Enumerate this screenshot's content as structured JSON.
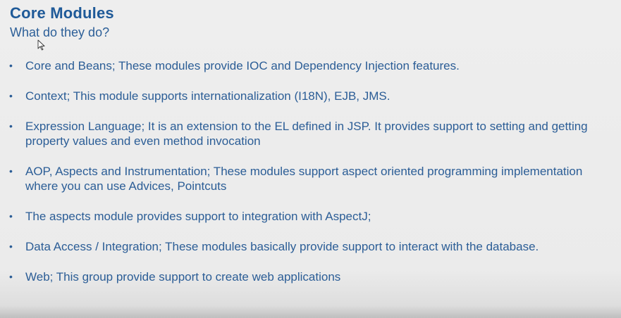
{
  "slide": {
    "title": "Core Modules",
    "subtitle": "What do they do?",
    "bullets": [
      "Core and Beans; These modules provide IOC and Dependency Injection features.",
      "Context; This module supports internationalization (I18N), EJB, JMS.",
      "Expression Language; It is an extension to the EL defined in JSP. It provides support to setting and getting property values and even method invocation",
      "AOP, Aspects and Instrumentation; These modules support aspect oriented programming implementation where you can use Advices, Pointcuts",
      "The aspects module provides support to integration with AspectJ;",
      "Data Access / Integration; These modules basically provide support to interact with the database.",
      "Web; This group provide support to create web applications"
    ]
  },
  "colors": {
    "title": "#1f5a98",
    "text": "#2b5d96",
    "background": "#ececec"
  },
  "icons": {
    "cursor": "mouse-pointer-icon",
    "bullet": "•"
  }
}
